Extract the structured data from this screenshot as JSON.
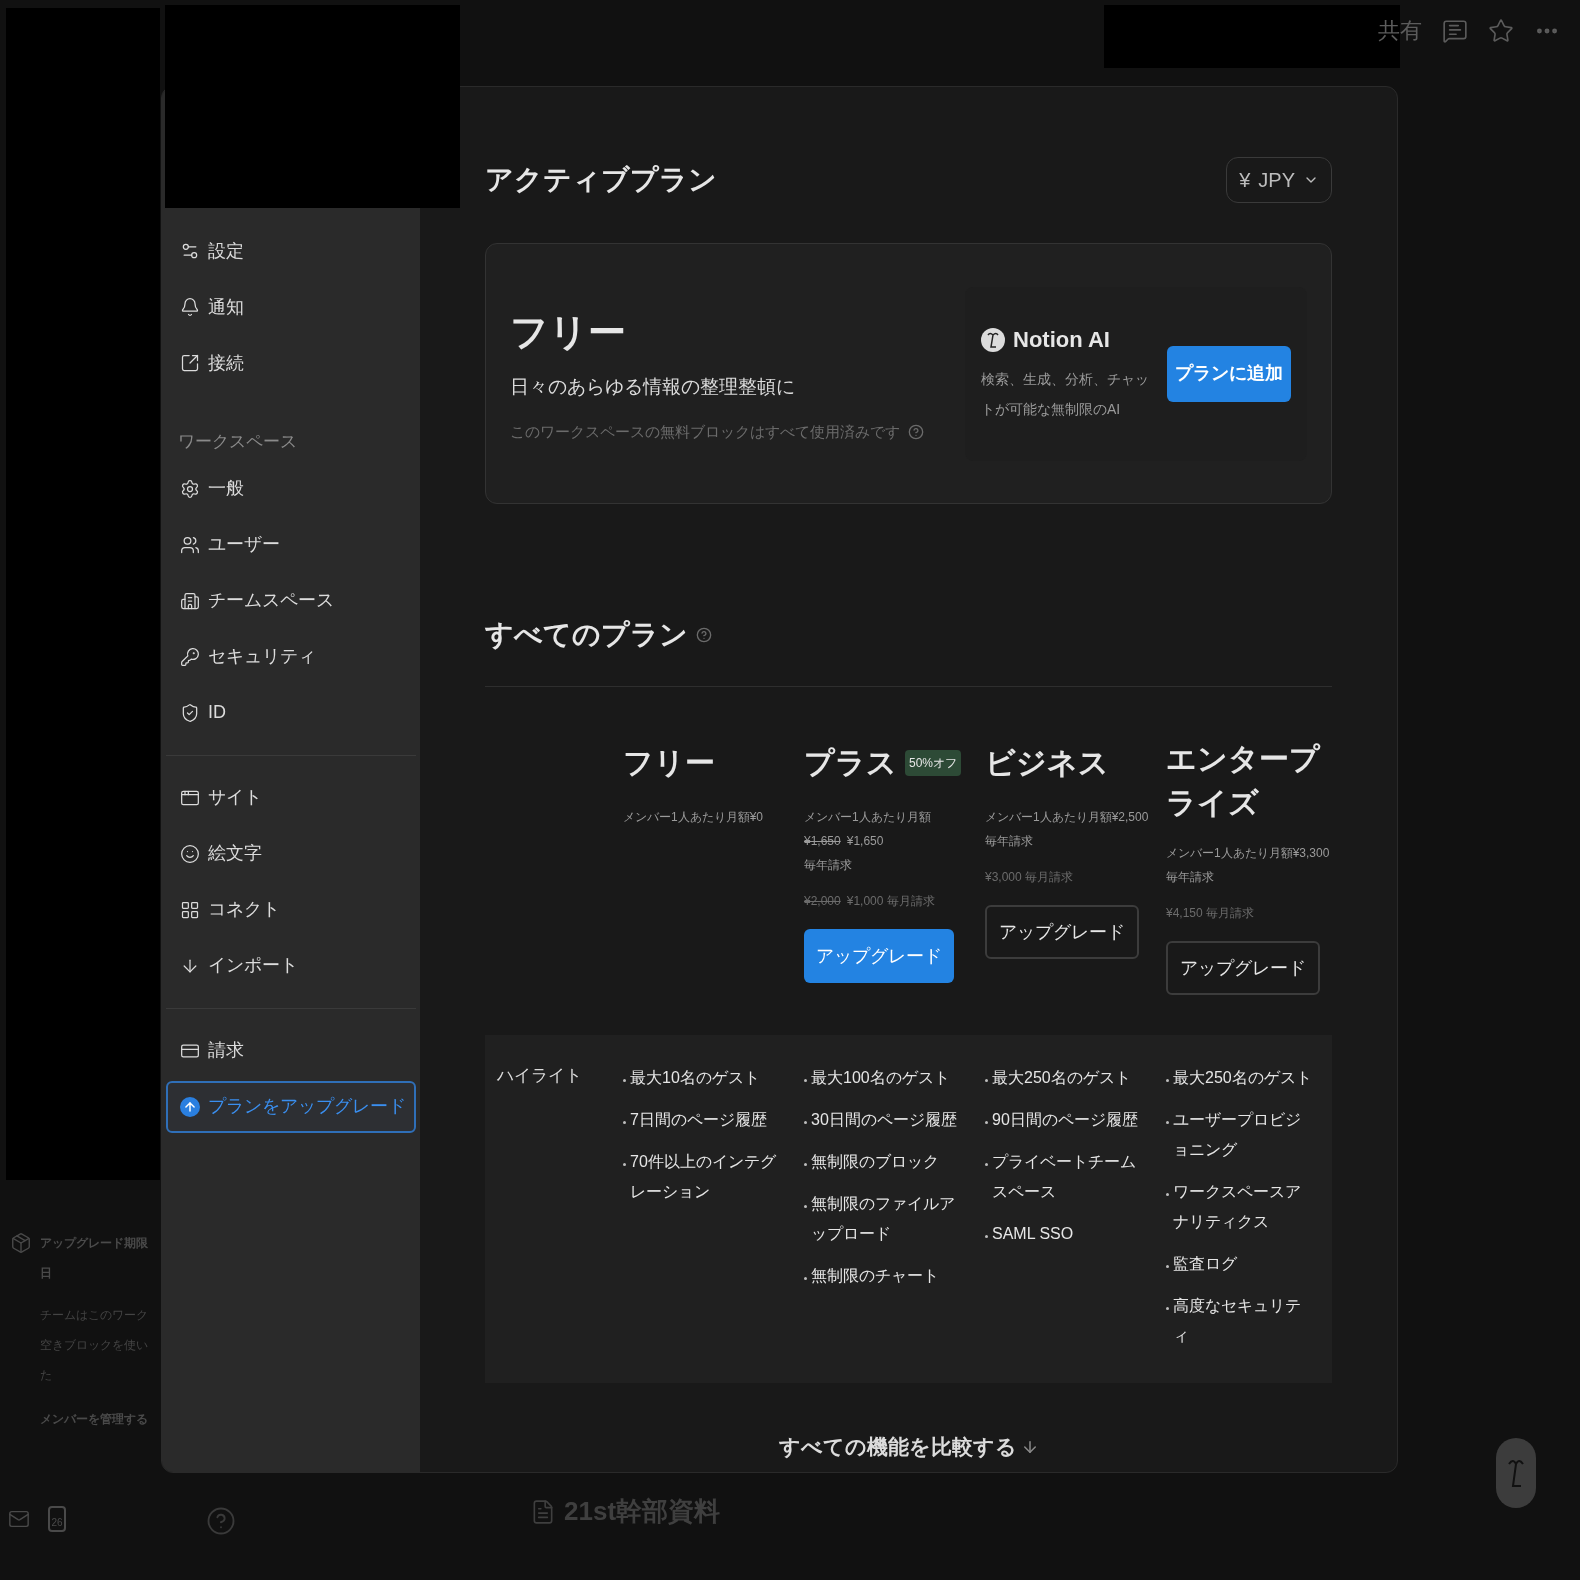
{
  "top_bar": {
    "share": "共有"
  },
  "background_sidebar": {
    "notice_title": [
      "アップグレード期限",
      "日"
    ],
    "notice_text": [
      "チームはこのワーク",
      "空きブロックを使い",
      "た"
    ],
    "notice_link": "メンバーを管理する",
    "calendar_day": "26"
  },
  "page_title": "21st幹部資料",
  "settings_sidebar": {
    "sections": [
      {
        "items": [
          {
            "label": "設定",
            "selected": false
          },
          {
            "label": "通知",
            "selected": false
          },
          {
            "label": "接続",
            "selected": false
          }
        ]
      },
      {
        "heading": "ワークスペース",
        "items": [
          {
            "label": "一般",
            "selected": false
          },
          {
            "label": "ユーザー",
            "selected": false
          },
          {
            "label": "チームスペース",
            "selected": false
          },
          {
            "label": "セキュリティ",
            "selected": false
          },
          {
            "label": "ID",
            "selected": false
          }
        ]
      },
      {
        "items": [
          {
            "label": "サイト",
            "selected": false
          },
          {
            "label": "絵文字",
            "selected": false
          },
          {
            "label": "コネクト",
            "selected": false
          },
          {
            "label": "インポート",
            "selected": false
          }
        ]
      },
      {
        "items": [
          {
            "label": "請求",
            "selected": false
          },
          {
            "label": "プランをアップグレード",
            "selected": true
          }
        ]
      }
    ]
  },
  "active_plan": {
    "title": "アクティブプラン",
    "currency": {
      "symbol": "¥",
      "label": "JPY"
    },
    "name": "フリー",
    "tagline": "日々のあらゆる情報の整理整頓に",
    "note": "このワークスペースの無料ブロックはすべて使用済みです",
    "addon": {
      "name": "Notion AI",
      "description": "検索、生成、分析、チャットが可能な無制限のAI",
      "button": "プランに追加"
    }
  },
  "all_plans": {
    "title": "すべてのプラン",
    "plans": [
      {
        "name": "フリー",
        "price_blocks": [
          [
            {
              "text": "メンバー1人あたり月額¥0"
            }
          ]
        ]
      },
      {
        "name": "プラス",
        "badge": "50%オフ",
        "price_blocks": [
          [
            {
              "text": "メンバー1人あたり月額"
            },
            {
              "old": "¥1,650",
              "text": "¥1,650"
            },
            {
              "text": "毎年請求"
            }
          ],
          [
            {
              "old": "¥2,000",
              "text": "¥1,000 毎月請求"
            }
          ]
        ],
        "button": {
          "label": "アップグレード",
          "primary": true
        }
      },
      {
        "name": "ビジネス",
        "price_blocks": [
          [
            {
              "text": "メンバー1人あたり月額¥2,500"
            },
            {
              "text": "毎年請求"
            }
          ],
          [
            {
              "text": "¥3,000 毎月請求"
            }
          ]
        ],
        "button": {
          "label": "アップグレード",
          "primary": false
        }
      },
      {
        "name": "エンタープライズ",
        "price_blocks": [
          [
            {
              "text": "メンバー1人あたり月額¥3,300"
            },
            {
              "text": "毎年請求"
            }
          ],
          [
            {
              "text": "¥4,150 毎月請求"
            }
          ]
        ],
        "button": {
          "label": "アップグレード",
          "primary": false
        }
      }
    ],
    "highlights": {
      "label": "ハイライト",
      "columns": [
        [
          "最大10名のゲスト",
          "7日間のページ履歴",
          "70件以上のインテグレーション"
        ],
        [
          "最大100名のゲスト",
          "30日間のページ履歴",
          "無制限のブロック",
          "無制限のファイルアップロード",
          "無制限のチャート"
        ],
        [
          "最大250名のゲスト",
          "90日間のページ履歴",
          "プライベートチームスペース",
          "SAML SSO"
        ],
        [
          "最大250名のゲスト",
          "ユーザープロビジョニング",
          "ワークスペースアナリティクス",
          "監査ログ",
          "高度なセキュリティ"
        ]
      ]
    },
    "compare_link": "すべての機能を比較する"
  }
}
